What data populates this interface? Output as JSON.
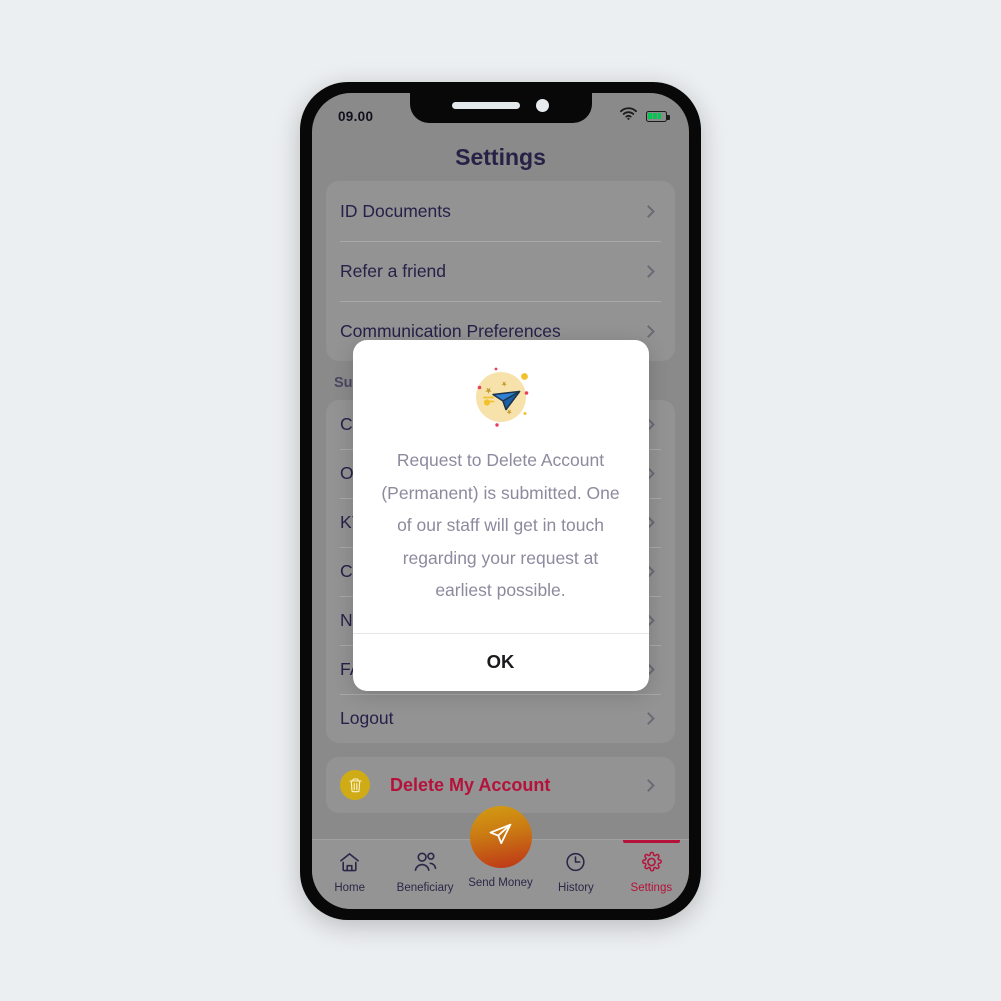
{
  "statusbar": {
    "time": "09.00",
    "wifi_icon": "wifi-icon",
    "battery_icon": "battery-icon",
    "battery_color": "#00c853"
  },
  "header": {
    "title": "Settings"
  },
  "settings": {
    "primary_items": [
      {
        "label": "ID Documents"
      },
      {
        "label": "Refer a friend"
      },
      {
        "label": "Communication Preferences"
      }
    ],
    "support_section_title": "Support",
    "support_items": [
      {
        "label": "C"
      },
      {
        "label": "O"
      },
      {
        "label": "KY"
      },
      {
        "label": "C"
      },
      {
        "label": "N"
      },
      {
        "label": "FA"
      },
      {
        "label": "Logout"
      }
    ],
    "delete_account": {
      "label": "Delete My Account",
      "icon": "trash-icon",
      "text_color": "#b5123b",
      "icon_bg": "#cfab16"
    }
  },
  "dialog": {
    "illustration": "paper-plane-illustration",
    "message": "Request to Delete Account (Permanent) is submitted. One of our staff will get in touch regarding your request at earliest possible.",
    "ok_label": "OK"
  },
  "bottomnav": {
    "items": [
      {
        "label": "Home",
        "icon": "home-icon",
        "active": false
      },
      {
        "label": "Beneficiary",
        "icon": "people-icon",
        "active": false
      },
      {
        "label": "Send Money",
        "icon": "send-plane-icon",
        "active": false
      },
      {
        "label": "History",
        "icon": "clock-icon",
        "active": false
      },
      {
        "label": "Settings",
        "icon": "gear-icon",
        "active": true
      }
    ],
    "active_color": "#b5123b"
  }
}
